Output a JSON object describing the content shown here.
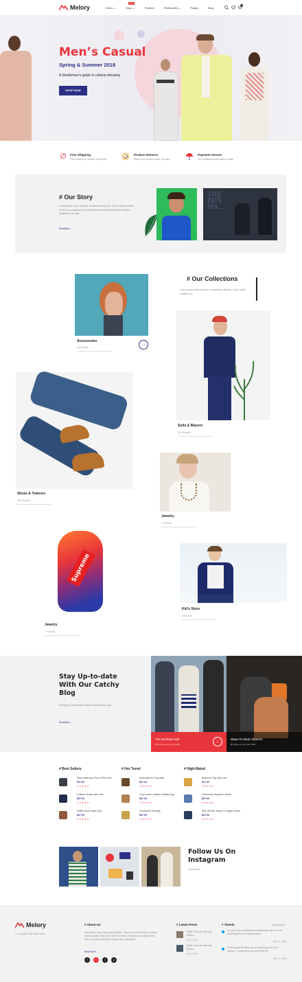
{
  "header": {
    "brand": "Melory",
    "nav": [
      {
        "label": "Demo",
        "caret": "⌄"
      },
      {
        "label": "Shop",
        "caret": "⌄",
        "badge": "Hot"
      },
      {
        "label": "Product",
        "caret": ""
      },
      {
        "label": "Shortcodes",
        "caret": "⌄"
      },
      {
        "label": "Pages",
        "caret": ""
      },
      {
        "label": "Blog",
        "caret": ""
      }
    ],
    "cart_count": "0"
  },
  "hero": {
    "title": "Men’s Casual",
    "subtitle": "Spring & Summer 2018",
    "description": "A Gentleman’s guide to urbane dressing",
    "button": "SHOP NOW"
  },
  "features": [
    {
      "title": "Free Shipping",
      "desc": "Free delivery for orders over $250",
      "icon": "rocket-icon"
    },
    {
      "title": "Product Returns",
      "desc": "Return the product within 30 days",
      "icon": "return-icon"
    },
    {
      "title": "Payment Secure",
      "desc": "Your individual information is safe",
      "icon": "umbrella-icon"
    }
  ],
  "story": {
    "title": "# Our Story",
    "text": "Lorem ipsum dolor sit amet, consectetur elig elis. Fusce vallus sodales est sit sed condimentum. Accumsan sit amet elit tincidunt molestie. Vestibulum est nisi.",
    "readmore": "ReadMore →",
    "film_caption": "THE BEN MA..."
  },
  "collections": {
    "title": "# Our Collections",
    "text": "Lorem ipsum dolor sit amet, consectetur elig elis. Fusce vallus sodales est.",
    "items": [
      {
        "name": "Accessories",
        "count": "15 Products"
      },
      {
        "name": "Suits & Blazers",
        "count": "281 Products"
      },
      {
        "name": "Shoes & Trainors",
        "count": "150 Products"
      },
      {
        "name": "Jewelry",
        "count": "7 Products"
      },
      {
        "name": "Kid’s Store",
        "count": "3 Products"
      },
      {
        "name": "Jewelry",
        "count": "7 Products"
      }
    ],
    "jacket_text": "Supreme"
  },
  "blog": {
    "title": "Stay Up-to-date With Our Catchy Blog",
    "text": "Trending & Everything related to the fashion topic",
    "readmore": "ReadMore →",
    "posts": [
      {
        "title": "The Zendaya Edit",
        "meta": "By Admin  on  Jan, 04, 2018"
      },
      {
        "title": "Ways To Wear: Blazers",
        "meta": "By Admin  on  Jan, 04, 2018"
      }
    ]
  },
  "products": {
    "columns": [
      {
        "title": "# Best Sellers",
        "items": [
          {
            "name": "Plush Batmoss Pho to iPho Zen",
            "price": "$67.00",
            "stars": "★★★★★"
          },
          {
            "name": "Leather shorts dark blue",
            "price": "$67.00",
            "stars": "★★★★★"
          },
          {
            "name": "Raffia tassel bolin Bag",
            "price": "$67.00",
            "stars": "★★★★★"
          }
        ]
      },
      {
        "title": "# Hot Trend",
        "items": [
          {
            "name": "Embroidered Clog Belt",
            "price": "$67.00",
            "stars": "★★★★★"
          },
          {
            "name": "Color block Leather Saddle Bag",
            "price": "$67.00",
            "stars": "★★★★★"
          },
          {
            "name": "Geometric Earrings",
            "price": "$67.00",
            "stars": "★★★★★"
          }
        ]
      },
      {
        "title": "# High-Rated",
        "items": [
          {
            "name": "Buttoned Top with Low",
            "price": "$67.00",
            "stars": "★★★★★"
          },
          {
            "name": "Chambray Gingham shorts",
            "price": "$67.00",
            "stars": "★★★★★"
          },
          {
            "name": "Slim Stretch Jeans in Indigo Denim",
            "price": "$67.00",
            "stars": "★★★★★"
          }
        ]
      }
    ]
  },
  "instagram": {
    "title": "Follow Us On Instagram",
    "handle": "@blogtheme"
  },
  "footer": {
    "brand": "Melory",
    "copyright": "© Copyright 2018 BlogoTheme",
    "about_title": "# About Us",
    "about_text": "Our fashion items never get outdated. They are not short-lived or normal fashion clothes. Moreover, with more than 20 years of operating in this field, our staff know how to ensure your satisfaction.",
    "readmore": "Read More →",
    "posts_title": "# Latest Posts",
    "posts": [
      {
        "title": "Outfits Tricks Are the New Fashion",
        "date": "Jan 6, 2018"
      },
      {
        "title": "Outfits Tricks Are the New Fashion",
        "date": "Jan 6, 2018"
      }
    ],
    "tweets_title": "# Tweets",
    "tweets_handle": "@blogotheme",
    "tweets": [
      {
        "text": "As part of our commitment to protect your data, we are launching the new Privacy Notice",
        "date": "Sep 14, 2018"
      },
      {
        "text": "Does anyone find that ads on Facebook tend to be rubbish? I would like to just turn them off...",
        "date": "Sep 14, 2018"
      }
    ],
    "social": [
      "f",
      "t",
      "t",
      "p"
    ]
  }
}
